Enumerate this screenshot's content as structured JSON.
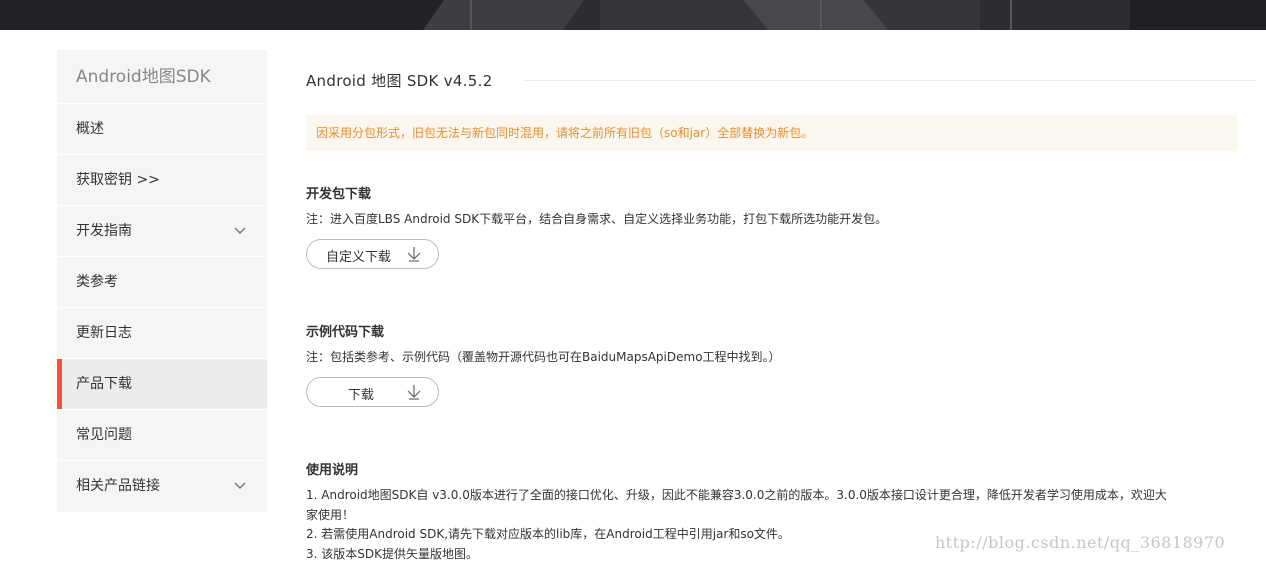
{
  "sidebar": {
    "title": "Android地图SDK",
    "items": [
      {
        "label": "概述"
      },
      {
        "label": "获取密钥 >>"
      },
      {
        "label": "开发指南"
      },
      {
        "label": "类参考"
      },
      {
        "label": "更新日志"
      },
      {
        "label": "产品下载"
      },
      {
        "label": "常见问题"
      },
      {
        "label": "相关产品链接"
      }
    ],
    "active_label": "产品下载",
    "active_color": "#f3533b"
  },
  "main": {
    "title": "Android 地图 SDK v4.5.2",
    "notice": "因采用分包形式，旧包无法与新包同时混用，请将之前所有旧包（so和jar）全部替换为新包。",
    "notice_color": "#e88e2c",
    "sections": [
      {
        "title": "开发包下载",
        "note": "注：进入百度LBS Android SDK下载平台，结合自身需求、自定义选择业务功能，打包下载所选功能开发包。",
        "button": "自定义下载"
      },
      {
        "title": "示例代码下载",
        "note": "注：包括类参考、示例代码（覆盖物开源代码也可在BaiduMapsApiDemo工程中找到。）",
        "button": "下载"
      },
      {
        "title": "使用说明",
        "lines": [
          "1. Android地图SDK自 v3.0.0版本进行了全面的接口优化、升级，因此不能兼容3.0.0之前的版本。3.0.0版本接口设计更合理，降低开发者学习使用成本，欢迎大",
          "家使用！",
          "2. 若需使用Android SDK,请先下载对应版本的lib库，在Android工程中引用jar和so文件。",
          "3. 该版本SDK提供矢量版地图。"
        ]
      }
    ]
  },
  "watermark": "http://blog.csdn.net/qq_36818970"
}
